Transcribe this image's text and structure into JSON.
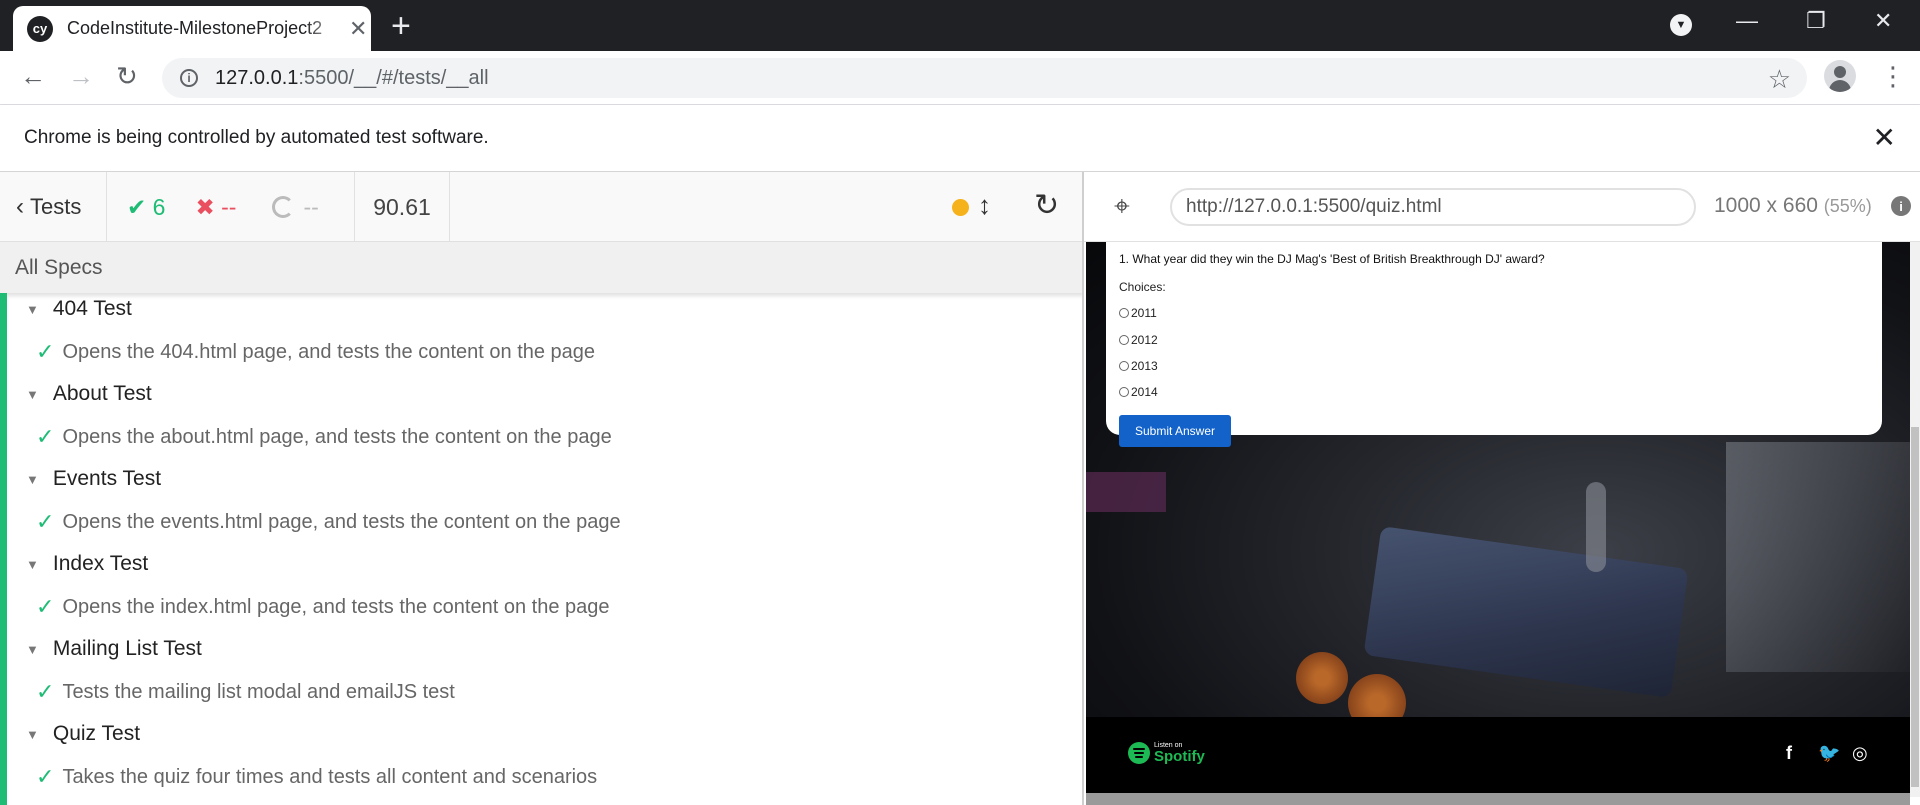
{
  "browser": {
    "tab_title": "CodeInstitute-MilestoneProject2",
    "favicon_text": "cy",
    "url_host": "127.0.0.1",
    "url_rest": ":5500/__/#/tests/__all",
    "infobar_text": "Chrome is being controlled by automated test software."
  },
  "reporter": {
    "tests_label": "Tests",
    "passed": "6",
    "failed": "--",
    "pending": "--",
    "duration": "90.61",
    "all_specs": "All Specs",
    "suites": [
      {
        "title": "404 Test",
        "test": "Opens the 404.html page, and tests the content on the page"
      },
      {
        "title": "About Test",
        "test": "Opens the about.html page, and tests the content on the page"
      },
      {
        "title": "Events Test",
        "test": "Opens the events.html page, and tests the content on the page"
      },
      {
        "title": "Index Test",
        "test": "Opens the index.html page, and tests the content on the page"
      },
      {
        "title": "Mailing List Test",
        "test": "Tests the mailing list modal and emailJS test"
      },
      {
        "title": "Quiz Test",
        "test": "Takes the quiz four times and tests all content and scenarios"
      }
    ]
  },
  "aut": {
    "url": "http://127.0.0.1:5500/quiz.html",
    "viewport": "1000 x 660",
    "scale": "(55%)",
    "quiz": {
      "question": "1. What year did they win the DJ Mag's 'Best of British Breakthrough DJ' award?",
      "choices_label": "Choices:",
      "choices": [
        "2011",
        "2012",
        "2013",
        "2014"
      ],
      "submit_label": "Submit Answer"
    },
    "footer": {
      "spotify_small": "Listen on",
      "spotify_big": "Spotify"
    }
  },
  "colors": {
    "pass": "#1fbc76",
    "fail": "#e94f5f",
    "running": "#f5b21a",
    "submit": "#1262c9"
  }
}
